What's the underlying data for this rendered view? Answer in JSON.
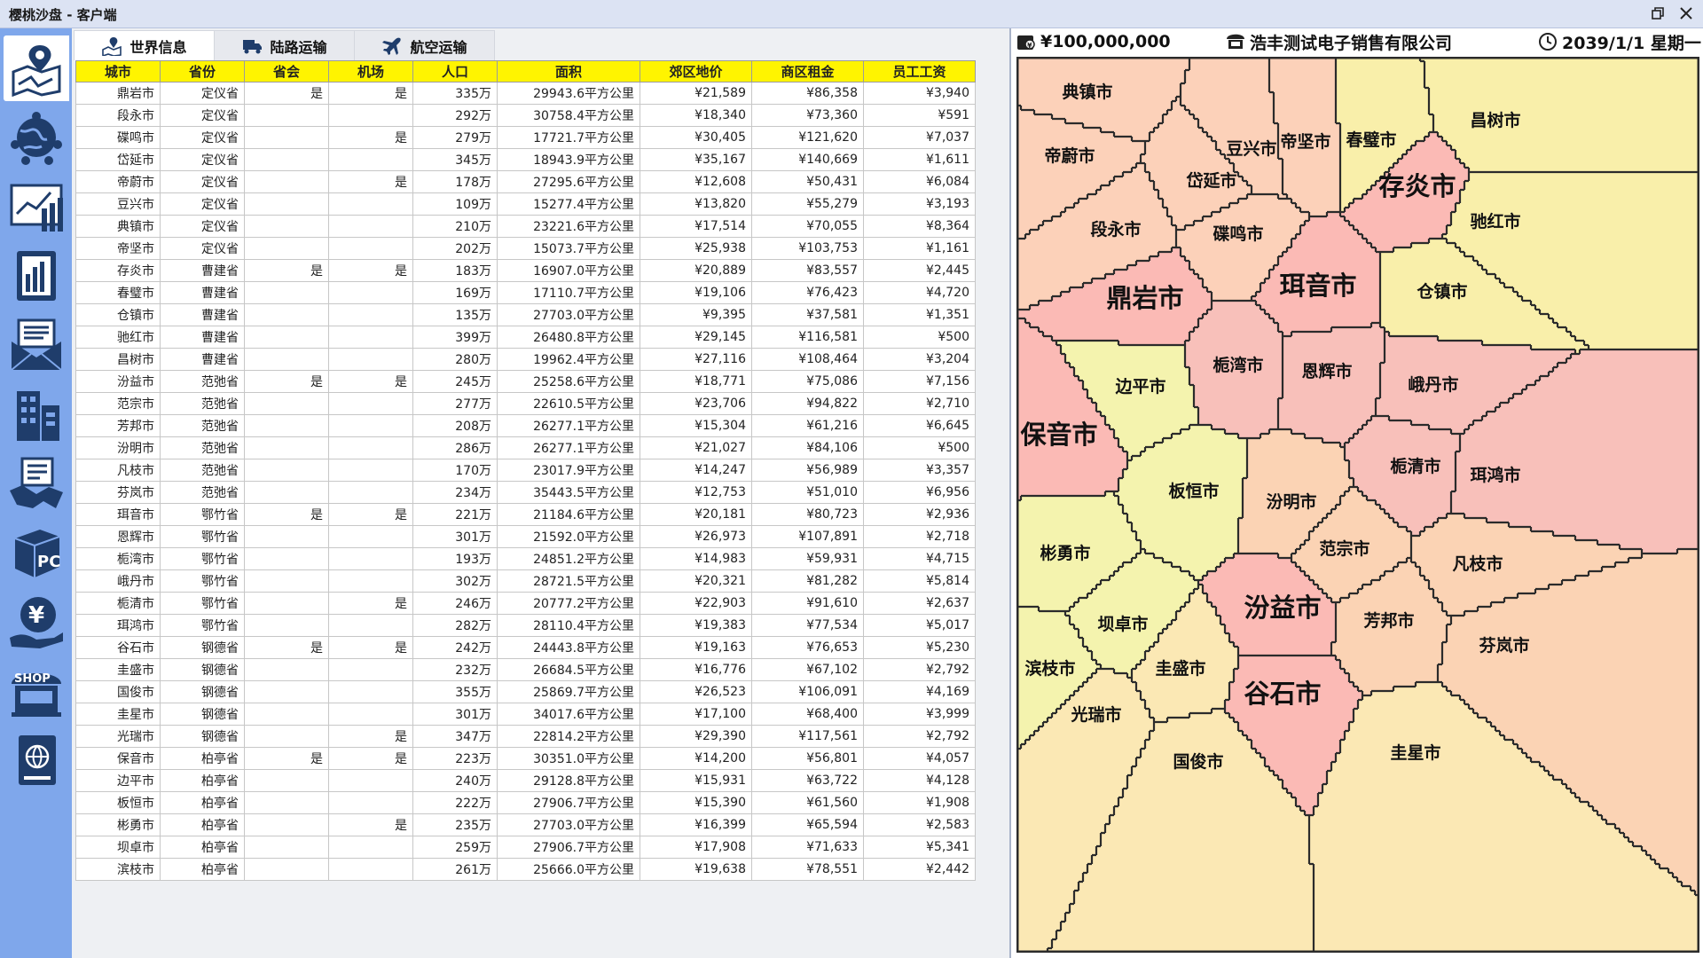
{
  "window": {
    "title": "樱桃沙盘 - 客户端"
  },
  "tabs": [
    {
      "label": "世界信息",
      "icon": "map-pin-icon"
    },
    {
      "label": "陆路运输",
      "icon": "truck-icon"
    },
    {
      "label": "航空运输",
      "icon": "airplane-icon"
    }
  ],
  "sidebar": {
    "items": [
      {
        "icon": "map-icon"
      },
      {
        "icon": "globe-network-icon"
      },
      {
        "icon": "chart-icon"
      },
      {
        "icon": "report-icon"
      },
      {
        "icon": "mail-icon"
      },
      {
        "icon": "building-icon"
      },
      {
        "icon": "handshake-icon"
      },
      {
        "icon": "pc-box-icon"
      },
      {
        "icon": "yen-icon"
      },
      {
        "icon": "shop-icon"
      },
      {
        "icon": "globe-book-icon"
      }
    ]
  },
  "table": {
    "columns": [
      "城市",
      "省份",
      "省会",
      "机场",
      "人口",
      "面积",
      "郊区地价",
      "商区租金",
      "员工工资"
    ],
    "rows": [
      [
        "鼎岩市",
        "定仪省",
        "是",
        "是",
        "335万",
        "29943.6平方公里",
        "¥21,589",
        "¥86,358",
        "¥3,940"
      ],
      [
        "段永市",
        "定仪省",
        "",
        "",
        "292万",
        "30758.4平方公里",
        "¥18,340",
        "¥73,360",
        "¥591"
      ],
      [
        "碟鸣市",
        "定仪省",
        "",
        "是",
        "279万",
        "17721.7平方公里",
        "¥30,405",
        "¥121,620",
        "¥7,037"
      ],
      [
        "岱延市",
        "定仪省",
        "",
        "",
        "345万",
        "18943.9平方公里",
        "¥35,167",
        "¥140,669",
        "¥1,611"
      ],
      [
        "帝蔚市",
        "定仪省",
        "",
        "是",
        "178万",
        "27295.6平方公里",
        "¥12,608",
        "¥50,431",
        "¥6,084"
      ],
      [
        "豆兴市",
        "定仪省",
        "",
        "",
        "109万",
        "15277.4平方公里",
        "¥13,820",
        "¥55,279",
        "¥3,193"
      ],
      [
        "典镇市",
        "定仪省",
        "",
        "",
        "210万",
        "23221.6平方公里",
        "¥17,514",
        "¥70,055",
        "¥8,364"
      ],
      [
        "帝坚市",
        "定仪省",
        "",
        "",
        "202万",
        "15073.7平方公里",
        "¥25,938",
        "¥103,753",
        "¥1,161"
      ],
      [
        "存炎市",
        "曹建省",
        "是",
        "是",
        "183万",
        "16907.0平方公里",
        "¥20,889",
        "¥83,557",
        "¥2,445"
      ],
      [
        "春璧市",
        "曹建省",
        "",
        "",
        "169万",
        "17110.7平方公里",
        "¥19,106",
        "¥76,423",
        "¥4,720"
      ],
      [
        "仓镇市",
        "曹建省",
        "",
        "",
        "135万",
        "27703.0平方公里",
        "¥9,395",
        "¥37,581",
        "¥1,351"
      ],
      [
        "驰红市",
        "曹建省",
        "",
        "",
        "399万",
        "26480.8平方公里",
        "¥29,145",
        "¥116,581",
        "¥500"
      ],
      [
        "昌树市",
        "曹建省",
        "",
        "",
        "280万",
        "19962.4平方公里",
        "¥27,116",
        "¥108,464",
        "¥3,204"
      ],
      [
        "汾益市",
        "范弛省",
        "是",
        "是",
        "245万",
        "25258.6平方公里",
        "¥18,771",
        "¥75,086",
        "¥7,156"
      ],
      [
        "范宗市",
        "范弛省",
        "",
        "",
        "277万",
        "22610.5平方公里",
        "¥23,706",
        "¥94,822",
        "¥2,710"
      ],
      [
        "芳邦市",
        "范弛省",
        "",
        "",
        "208万",
        "26277.1平方公里",
        "¥15,304",
        "¥61,216",
        "¥6,645"
      ],
      [
        "汾明市",
        "范弛省",
        "",
        "",
        "286万",
        "26277.1平方公里",
        "¥21,027",
        "¥84,106",
        "¥500"
      ],
      [
        "凡枝市",
        "范弛省",
        "",
        "",
        "170万",
        "23017.9平方公里",
        "¥14,247",
        "¥56,989",
        "¥3,357"
      ],
      [
        "芬岚市",
        "范弛省",
        "",
        "",
        "234万",
        "35443.5平方公里",
        "¥12,753",
        "¥51,010",
        "¥6,956"
      ],
      [
        "珥音市",
        "鄂竹省",
        "是",
        "是",
        "221万",
        "21184.6平方公里",
        "¥20,181",
        "¥80,723",
        "¥2,936"
      ],
      [
        "恩辉市",
        "鄂竹省",
        "",
        "",
        "301万",
        "21592.0平方公里",
        "¥26,973",
        "¥107,891",
        "¥2,718"
      ],
      [
        "栀湾市",
        "鄂竹省",
        "",
        "",
        "193万",
        "24851.2平方公里",
        "¥14,983",
        "¥59,931",
        "¥4,715"
      ],
      [
        "峨丹市",
        "鄂竹省",
        "",
        "",
        "302万",
        "28721.5平方公里",
        "¥20,321",
        "¥81,282",
        "¥5,814"
      ],
      [
        "栀清市",
        "鄂竹省",
        "",
        "是",
        "246万",
        "20777.2平方公里",
        "¥22,903",
        "¥91,610",
        "¥2,637"
      ],
      [
        "珥鸿市",
        "鄂竹省",
        "",
        "",
        "282万",
        "28110.4平方公里",
        "¥19,383",
        "¥77,534",
        "¥5,017"
      ],
      [
        "谷石市",
        "钢德省",
        "是",
        "是",
        "242万",
        "24443.8平方公里",
        "¥19,163",
        "¥76,653",
        "¥5,230"
      ],
      [
        "圭盛市",
        "钢德省",
        "",
        "",
        "232万",
        "26684.5平方公里",
        "¥16,776",
        "¥67,102",
        "¥2,792"
      ],
      [
        "国俊市",
        "钢德省",
        "",
        "",
        "355万",
        "25869.7平方公里",
        "¥26,523",
        "¥106,091",
        "¥4,169"
      ],
      [
        "圭星市",
        "钢德省",
        "",
        "",
        "301万",
        "34017.6平方公里",
        "¥17,100",
        "¥68,400",
        "¥3,999"
      ],
      [
        "光瑞市",
        "钢德省",
        "",
        "是",
        "347万",
        "22814.2平方公里",
        "¥29,390",
        "¥117,561",
        "¥2,792"
      ],
      [
        "保音市",
        "柏亭省",
        "是",
        "是",
        "223万",
        "30351.0平方公里",
        "¥14,200",
        "¥56,801",
        "¥4,057"
      ],
      [
        "边平市",
        "柏亭省",
        "",
        "",
        "240万",
        "29128.8平方公里",
        "¥15,931",
        "¥63,722",
        "¥4,128"
      ],
      [
        "板恒市",
        "柏亭省",
        "",
        "",
        "222万",
        "27906.7平方公里",
        "¥15,390",
        "¥61,560",
        "¥1,908"
      ],
      [
        "彬勇市",
        "柏亭省",
        "",
        "是",
        "235万",
        "27703.0平方公里",
        "¥16,399",
        "¥65,594",
        "¥2,583"
      ],
      [
        "坝卓市",
        "柏亭省",
        "",
        "",
        "259万",
        "27906.7平方公里",
        "¥17,908",
        "¥71,633",
        "¥5,341"
      ],
      [
        "滨枝市",
        "柏亭省",
        "",
        "",
        "261万",
        "25666.0平方公里",
        "¥19,638",
        "¥78,551",
        "¥2,442"
      ]
    ]
  },
  "hud": {
    "money": "¥100,000,000",
    "company": "浩丰测试电子销售有限公司",
    "date": "2039/1/1 星期一"
  },
  "colors": {
    "定仪省": "#fcd1b9",
    "曹建省": "#f9efaa",
    "范弛省": "#fbd3b4",
    "鄂竹省": "#f8c0ba",
    "钢德省": "#fbe8b4",
    "柏亭省": "#f4f3ae",
    "capital": "#fbbab5",
    "highlight": "#f3f7b2"
  },
  "map": {
    "cities": [
      {
        "name": "典镇市",
        "size": "s"
      },
      {
        "name": "帝蔚市",
        "size": "s"
      },
      {
        "name": "豆兴市",
        "size": "s"
      },
      {
        "name": "帝坚市",
        "size": "s"
      },
      {
        "name": "春璧市",
        "size": "s"
      },
      {
        "name": "昌树市",
        "size": "s"
      },
      {
        "name": "岱延市",
        "size": "s"
      },
      {
        "name": "存炎市",
        "size": "l"
      },
      {
        "name": "段永市",
        "size": "s"
      },
      {
        "name": "驰红市",
        "size": "s"
      },
      {
        "name": "碟鸣市",
        "size": "s"
      },
      {
        "name": "鼎岩市",
        "size": "l"
      },
      {
        "name": "珥音市",
        "size": "l"
      },
      {
        "name": "仓镇市",
        "size": "s"
      },
      {
        "name": "栀湾市",
        "size": "s"
      },
      {
        "name": "恩辉市",
        "size": "s"
      },
      {
        "name": "边平市",
        "size": "s"
      },
      {
        "name": "峨丹市",
        "size": "s"
      },
      {
        "name": "保音市",
        "size": "l"
      },
      {
        "name": "栀清市",
        "size": "s"
      },
      {
        "name": "珥鸿市",
        "size": "s"
      },
      {
        "name": "板恒市",
        "size": "s"
      },
      {
        "name": "汾明市",
        "size": "s"
      },
      {
        "name": "彬勇市",
        "size": "s"
      },
      {
        "name": "范宗市",
        "size": "s"
      },
      {
        "name": "凡枝市",
        "size": "s"
      },
      {
        "name": "汾益市",
        "size": "l"
      },
      {
        "name": "坝卓市",
        "size": "s"
      },
      {
        "name": "芳邦市",
        "size": "s"
      },
      {
        "name": "芬岚市",
        "size": "s"
      },
      {
        "name": "滨枝市",
        "size": "s"
      },
      {
        "name": "圭盛市",
        "size": "s"
      },
      {
        "name": "谷石市",
        "size": "l"
      },
      {
        "name": "光瑞市",
        "size": "s"
      },
      {
        "name": "国俊市",
        "size": "s"
      },
      {
        "name": "圭星市",
        "size": "s"
      }
    ]
  }
}
